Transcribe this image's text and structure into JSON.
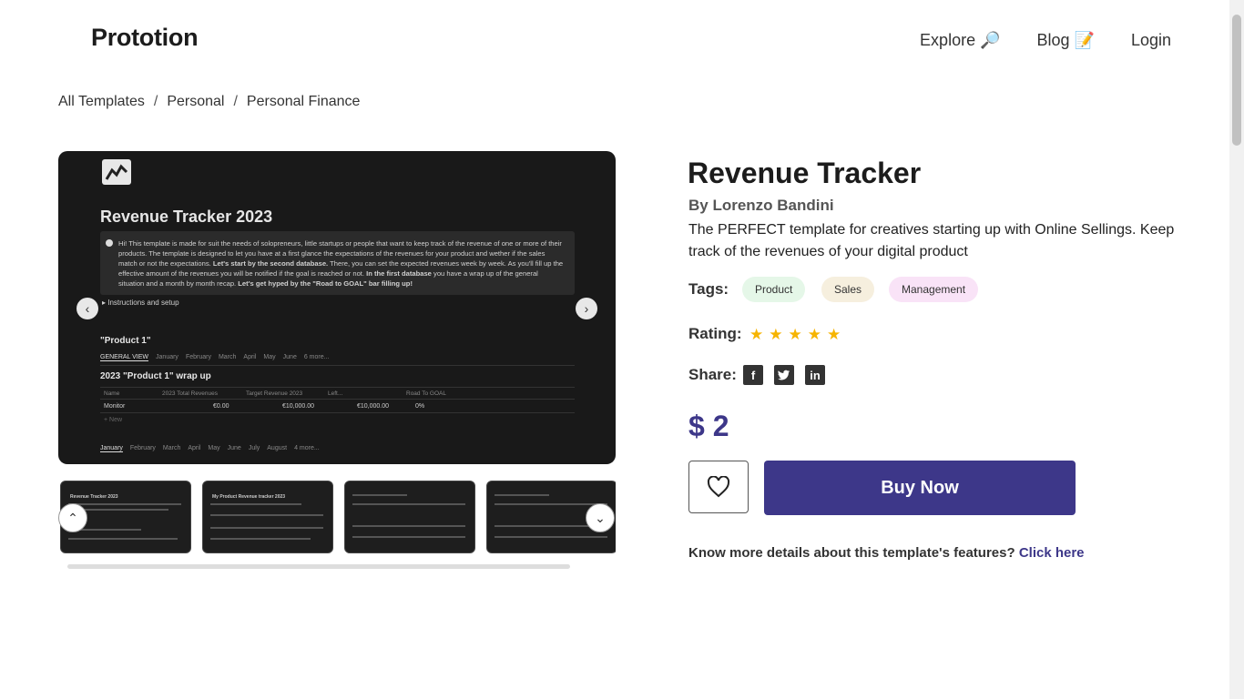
{
  "header": {
    "logo": "Prototion",
    "nav": {
      "explore": "Explore 🔎",
      "blog": "Blog 📝",
      "login": "Login"
    }
  },
  "breadcrumb": {
    "items": [
      "All Templates",
      "Personal",
      "Personal Finance"
    ],
    "separator": "/"
  },
  "preview": {
    "doc_title": "Revenue Tracker 2023",
    "callout_text_1": "Hi! This template is made for suit the needs of solopreneurs, little startups or people that want to keep track of the revenue of one or more of their products. The template is designed to let you have at a first glance the expectations of the revenues for your product and wether if the sales match or not the expectations.",
    "callout_bold_1": "Let's start by the second database.",
    "callout_text_2": "There, you can set the expected revenues week by week. As you'll fill up the effective amount of the revenues you will be notified if the goal is reached or not.",
    "callout_bold_2": "In the first database",
    "callout_text_3": "you have a wrap up of the general situation and a month by month recap.",
    "callout_bold_3": "Let's get hyped by the \"Road to GOAL\" bar filling up!",
    "toggle": "Instructions and setup",
    "product_heading": "\"Product 1\"",
    "tabs": [
      "GENERAL VIEW",
      "January",
      "February",
      "March",
      "April",
      "May",
      "June",
      "6 more..."
    ],
    "wrap_heading": "2023 \"Product 1\" wrap up",
    "table_headers": [
      "Name",
      "2023 Total Revenues",
      "Target Revenue 2023",
      "Left...",
      "Road To GOAL"
    ],
    "table_row": [
      "Monitor",
      "€0.00",
      "€10,000.00",
      "€10,000.00",
      "0%"
    ],
    "new_label": "+ New",
    "tabs_bottom": [
      "January",
      "February",
      "March",
      "April",
      "May",
      "June",
      "July",
      "August",
      "4 more..."
    ]
  },
  "thumbnails": [
    {
      "title": "Revenue Tracker 2023"
    },
    {
      "title": "My Product Revenue tracker 2023"
    },
    {
      "title": ""
    },
    {
      "title": ""
    }
  ],
  "product": {
    "title": "Revenue Tracker",
    "author": "By Lorenzo Bandini",
    "description": "The PERFECT template for creatives starting up with Online Sellings. Keep track of the revenues of your digital product",
    "tags_label": "Tags:",
    "tags": [
      "Product",
      "Sales",
      "Management"
    ],
    "rating_label": "Rating:",
    "rating": 5,
    "rating_max": 5,
    "share_label": "Share:",
    "price": "$ 2",
    "buy_label": "Buy Now",
    "more_text": "Know more details about this template's features?",
    "more_link": "Click here"
  },
  "colors": {
    "accent": "#3d3789",
    "star": "#f6b400"
  },
  "icons": [
    "chart-icon",
    "heart-icon",
    "facebook-icon",
    "twitter-icon",
    "linkedin-icon",
    "chevron-left-icon",
    "chevron-right-icon",
    "chevron-up-icon",
    "chevron-down-icon"
  ]
}
